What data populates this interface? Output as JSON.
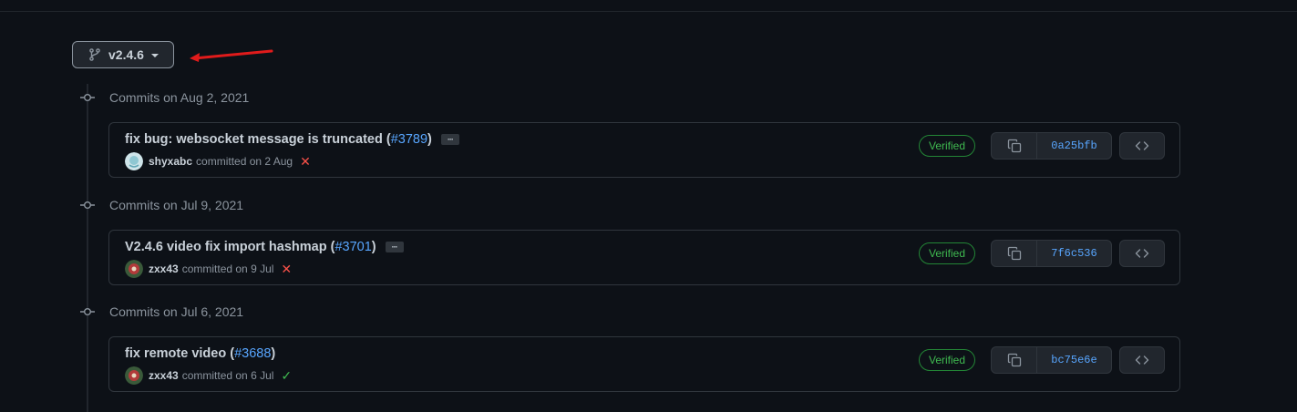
{
  "branch": {
    "name": "v2.4.6",
    "icon": "git-branch-icon"
  },
  "groups": [
    {
      "heading": "Commits on Aug 2, 2021",
      "commit": {
        "title": "fix bug: websocket message is truncated (",
        "pr": "#3789",
        "title_end": ")",
        "ellipsis": "···",
        "author": "shyxabc",
        "committed": "committed on 2 Aug",
        "status": "✕",
        "verified": "Verified",
        "sha": "0a25bfb"
      }
    },
    {
      "heading": "Commits on Jul 9, 2021",
      "commit": {
        "title": "V2.4.6 video fix import hashmap (",
        "pr": "#3701",
        "title_end": ")",
        "ellipsis": "···",
        "author": "zxx43",
        "committed": "committed on 9 Jul",
        "status": "✕",
        "verified": "Verified",
        "sha": "7f6c536"
      }
    },
    {
      "heading": "Commits on Jul 6, 2021",
      "commit": {
        "title": "fix remote video (",
        "pr": "#3688",
        "title_end": ")",
        "author": "zxx43",
        "committed": "committed on 6 Jul",
        "status": "✓",
        "verified": "Verified",
        "sha": "bc75e6e"
      }
    }
  ],
  "colors": {
    "accent": "#58a6ff",
    "success": "#3fb950",
    "danger": "#f85149",
    "annotation_arrow": "#e01b1b"
  }
}
